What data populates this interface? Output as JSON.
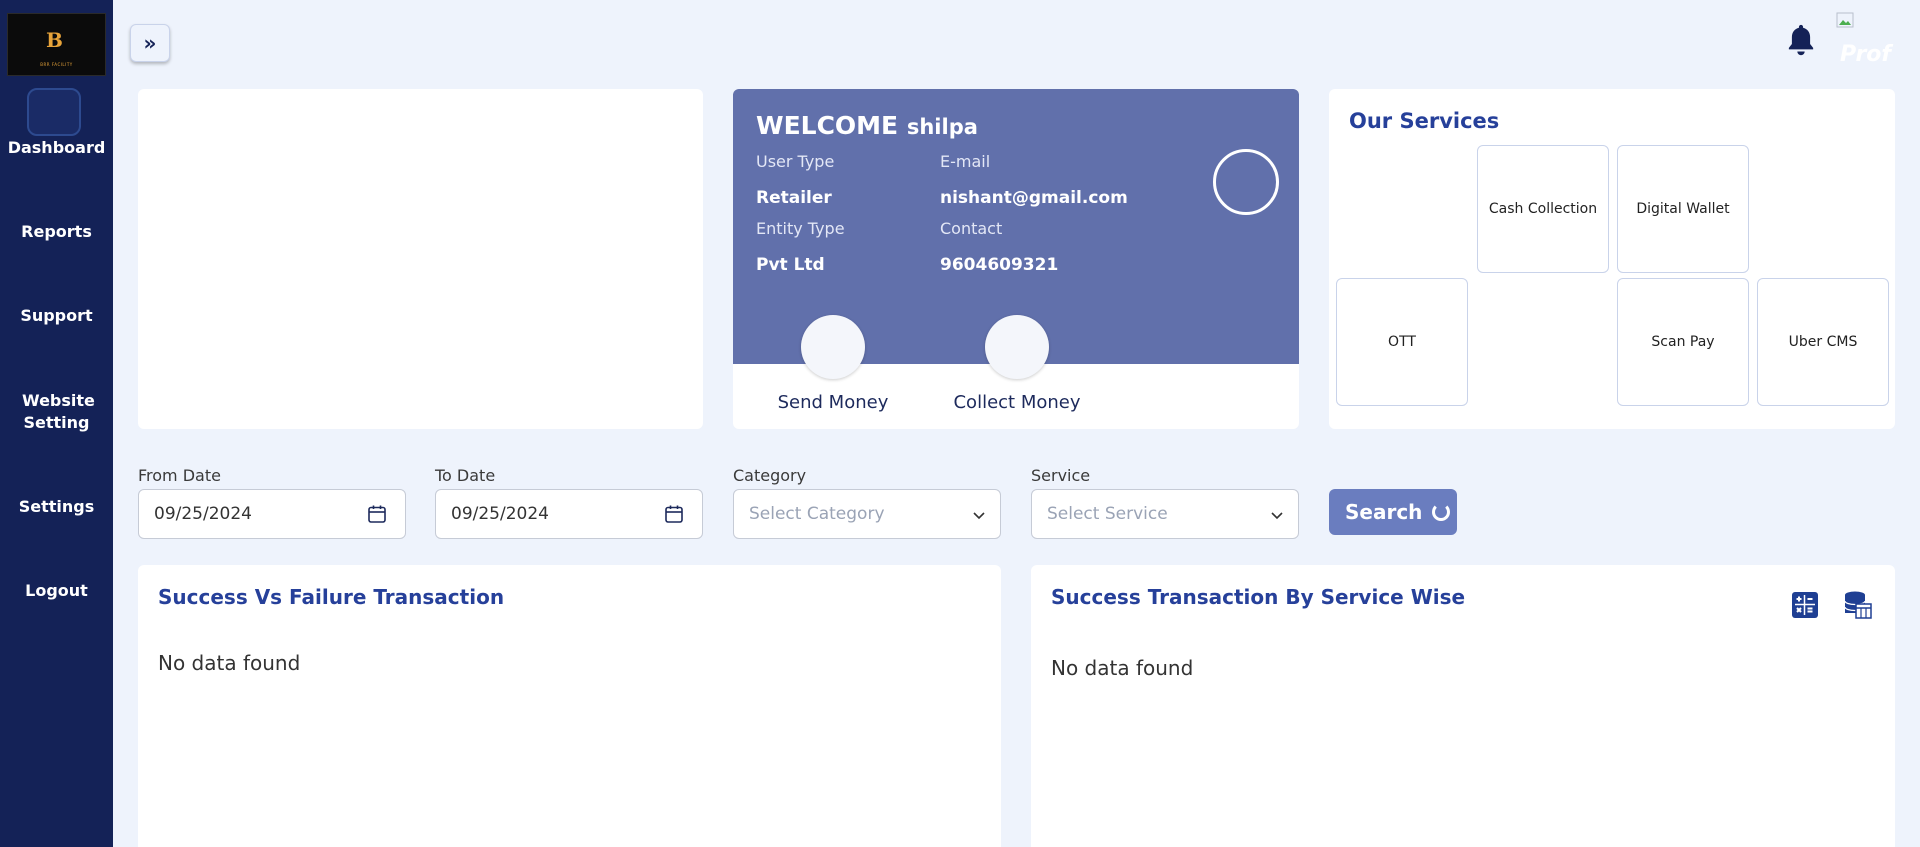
{
  "brand": {
    "logo_letter": "B",
    "logo_text": "BRR FACILITY"
  },
  "sidebar": {
    "items": [
      {
        "label": "Dashboard"
      },
      {
        "label": "Reports"
      },
      {
        "label": "Support"
      },
      {
        "label": "Website Setting"
      },
      {
        "label": "Settings"
      },
      {
        "label": "Logout"
      }
    ]
  },
  "header": {
    "profile_alt": "Prof"
  },
  "welcome": {
    "greeting": "WELCOME",
    "name": "shilpa",
    "user_type_label": "User Type",
    "user_type": "Retailer",
    "email_label": "E-mail",
    "email": "nishant@gmail.com",
    "entity_type_label": "Entity Type",
    "entity_type": "Pvt Ltd",
    "contact_label": "Contact",
    "contact": "9604609321",
    "actions": [
      {
        "label": "Send Money"
      },
      {
        "label": "Collect Money"
      }
    ]
  },
  "services": {
    "title": "Our Services",
    "tiles": [
      {
        "label": "Cash Collection"
      },
      {
        "label": "Digital Wallet"
      },
      {
        "label": "OTT"
      },
      {
        "label": "Scan Pay"
      },
      {
        "label": "Uber CMS"
      }
    ]
  },
  "filters": {
    "from_date_label": "From Date",
    "from_date": "09/25/2024",
    "to_date_label": "To Date",
    "to_date": "09/25/2024",
    "category_label": "Category",
    "category_placeholder": "Select Category",
    "service_label": "Service",
    "service_placeholder": "Select Service",
    "search_label": "Search"
  },
  "panels": {
    "left": {
      "title": "Success Vs Failure Transaction",
      "empty": "No data found"
    },
    "right": {
      "title": "Success Transaction By Service Wise",
      "empty": "No data found"
    }
  },
  "colors": {
    "sidebar": "#142257",
    "welcome_card": "#6170ab",
    "accent_title": "#26409a",
    "search_button": "#6a7dbf",
    "background": "#eef3fc"
  }
}
